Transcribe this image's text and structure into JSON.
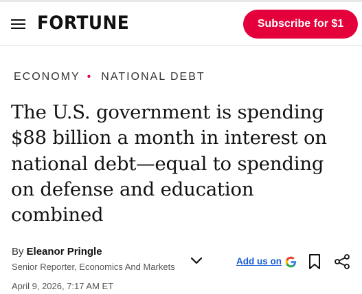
{
  "header": {
    "logo": "FORTUNE",
    "subscribe_label": "Subscribe for $1",
    "menu_icon": "hamburger-menu-icon"
  },
  "breadcrumbs": [
    "ECONOMY",
    "NATIONAL DEBT"
  ],
  "article": {
    "headline_lines": [
      "The U.S. government is spending",
      "$88 billion a month in interest on",
      "national debt—equal to spending",
      "on defense and education",
      "combined"
    ],
    "byline_prefix": "By",
    "author": "Eleanor Pringle",
    "author_role": "Senior Reporter, Economics And Markets",
    "date": "April 9, 2026, 7:17 AM ET"
  },
  "actions": {
    "add_us_label": "Add us on",
    "icons": [
      "google-icon",
      "bookmark-icon",
      "share-icon",
      "chevron-down-icon"
    ]
  },
  "colors": {
    "brand_red": "#e4003a",
    "link_blue": "#1a5cd6"
  }
}
